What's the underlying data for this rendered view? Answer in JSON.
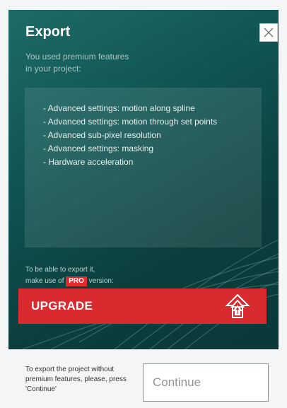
{
  "dialog": {
    "title": "Export",
    "subtitle": "You used premium features\nin your project:",
    "close_icon": "close-icon",
    "features": [
      "- Advanced settings: motion along spline",
      "- Advanced settings: motion through set points",
      "- Advanced sub-pixel resolution",
      "- Advanced settings: masking",
      "- Hardware acceleration"
    ],
    "export_note_line1": "To be able to export it,",
    "export_note_prefix": "make use of",
    "pro_label": "PRO",
    "export_note_suffix": "version:",
    "upgrade_label": "UPGRADE",
    "upgrade_icon": "upgrade-arrow-icon",
    "bottom_text": "To export the project without premium features, please, press 'Continue'",
    "continue_label": "Continue"
  },
  "colors": {
    "panel": "#115553",
    "upgrade": "#d82a2f",
    "pro_badge": "#e4292f"
  }
}
